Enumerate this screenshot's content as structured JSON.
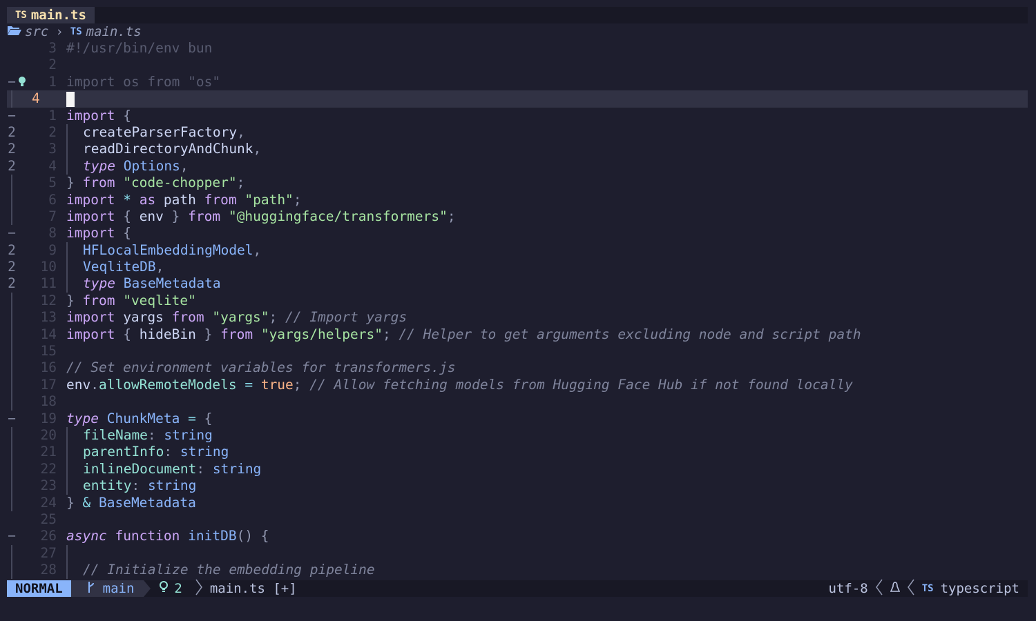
{
  "tabline": {
    "badge": "TS",
    "filename": "main.ts"
  },
  "winbar": {
    "folder_icon": "folder-open-icon",
    "dir": "src",
    "separator": "›",
    "badge": "TS",
    "file": "main.ts"
  },
  "buffer": {
    "lines": [
      {
        "fold": "",
        "sign": "",
        "nr": "3",
        "tokens": [
          [
            "dim",
            "#!/usr/bin/env bun",
            "plain"
          ]
        ]
      },
      {
        "fold": "",
        "sign": "",
        "nr": "2",
        "tokens": []
      },
      {
        "fold": "−",
        "sign": "lightbulb-icon",
        "nr": "1",
        "tokens": [
          [
            "dim",
            "import os from \"os\""
          ]
        ]
      },
      {
        "fold": "│",
        "sign": "",
        "nr": "4",
        "current": true,
        "tokens": []
      },
      {
        "fold": "−",
        "sign": "",
        "nr": "1",
        "tokens": [
          [
            "kw",
            "import"
          ],
          [
            "pu",
            " {"
          ]
        ]
      },
      {
        "fold": "2",
        "sign": "",
        "nr": "2",
        "indent": true,
        "tokens": [
          [
            "plain",
            "createParserFactory"
          ],
          [
            "pu",
            ","
          ]
        ]
      },
      {
        "fold": "2",
        "sign": "",
        "nr": "3",
        "indent": true,
        "tokens": [
          [
            "plain",
            "readDirectoryAndChunk"
          ],
          [
            "pu",
            ","
          ]
        ]
      },
      {
        "fold": "2",
        "sign": "",
        "nr": "4",
        "indent": true,
        "tokens": [
          [
            "it",
            "type"
          ],
          [
            "plain",
            " "
          ],
          [
            "ty",
            "Options"
          ],
          [
            "pu",
            ","
          ]
        ]
      },
      {
        "fold": "│",
        "sign": "",
        "nr": "5",
        "tokens": [
          [
            "pu",
            "} "
          ],
          [
            "kw",
            "from"
          ],
          [
            "plain",
            " "
          ],
          [
            "str",
            "\"code-chopper\""
          ],
          [
            "pu",
            ";"
          ]
        ]
      },
      {
        "fold": "│",
        "sign": "",
        "nr": "6",
        "tokens": [
          [
            "kw",
            "import"
          ],
          [
            "plain",
            " "
          ],
          [
            "op",
            "*"
          ],
          [
            "plain",
            " "
          ],
          [
            "kw",
            "as"
          ],
          [
            "plain",
            " path "
          ],
          [
            "kw",
            "from"
          ],
          [
            "plain",
            " "
          ],
          [
            "str",
            "\"path\""
          ],
          [
            "pu",
            ";"
          ]
        ]
      },
      {
        "fold": "│",
        "sign": "",
        "nr": "7",
        "tokens": [
          [
            "kw",
            "import"
          ],
          [
            "pu",
            " { "
          ],
          [
            "plain",
            "env"
          ],
          [
            "pu",
            " } "
          ],
          [
            "kw",
            "from"
          ],
          [
            "plain",
            " "
          ],
          [
            "str",
            "\"@huggingface/transformers\""
          ],
          [
            "pu",
            ";"
          ]
        ]
      },
      {
        "fold": "−",
        "sign": "",
        "nr": "8",
        "tokens": [
          [
            "kw",
            "import"
          ],
          [
            "pu",
            " {"
          ]
        ]
      },
      {
        "fold": "2",
        "sign": "",
        "nr": "9",
        "indent": true,
        "tokens": [
          [
            "ty",
            "HFLocalEmbeddingModel"
          ],
          [
            "pu",
            ","
          ]
        ]
      },
      {
        "fold": "2",
        "sign": "",
        "nr": "10",
        "indent": true,
        "tokens": [
          [
            "ty",
            "VeqliteDB"
          ],
          [
            "pu",
            ","
          ]
        ]
      },
      {
        "fold": "2",
        "sign": "",
        "nr": "11",
        "indent": true,
        "tokens": [
          [
            "it",
            "type"
          ],
          [
            "plain",
            " "
          ],
          [
            "ty",
            "BaseMetadata"
          ]
        ]
      },
      {
        "fold": "│",
        "sign": "",
        "nr": "12",
        "tokens": [
          [
            "pu",
            "} "
          ],
          [
            "kw",
            "from"
          ],
          [
            "plain",
            " "
          ],
          [
            "str",
            "\"veqlite\""
          ]
        ]
      },
      {
        "fold": "│",
        "sign": "",
        "nr": "13",
        "tokens": [
          [
            "kw",
            "import"
          ],
          [
            "plain",
            " yargs "
          ],
          [
            "kw",
            "from"
          ],
          [
            "plain",
            " "
          ],
          [
            "str",
            "\"yargs\""
          ],
          [
            "pu",
            "; "
          ],
          [
            "cm",
            "// Import yargs"
          ]
        ]
      },
      {
        "fold": "│",
        "sign": "",
        "nr": "14",
        "tokens": [
          [
            "kw",
            "import"
          ],
          [
            "pu",
            " { "
          ],
          [
            "plain",
            "hideBin"
          ],
          [
            "pu",
            " } "
          ],
          [
            "kw",
            "from"
          ],
          [
            "plain",
            " "
          ],
          [
            "str",
            "\"yargs/helpers\""
          ],
          [
            "pu",
            "; "
          ],
          [
            "cm",
            "// Helper to get arguments excluding node and script path"
          ]
        ]
      },
      {
        "fold": "│",
        "sign": "",
        "nr": "15",
        "tokens": []
      },
      {
        "fold": "│",
        "sign": "",
        "nr": "16",
        "tokens": [
          [
            "cm",
            "// Set environment variables for transformers.js"
          ]
        ]
      },
      {
        "fold": "│",
        "sign": "",
        "nr": "17",
        "tokens": [
          [
            "plain",
            "env"
          ],
          [
            "pu",
            "."
          ],
          [
            "pr",
            "allowRemoteModels"
          ],
          [
            "plain",
            " "
          ],
          [
            "op",
            "="
          ],
          [
            "plain",
            " "
          ],
          [
            "bool",
            "true"
          ],
          [
            "pu",
            "; "
          ],
          [
            "cm",
            "// Allow fetching models from Hugging Face Hub if not found locally"
          ]
        ]
      },
      {
        "fold": "│",
        "sign": "",
        "nr": "18",
        "tokens": []
      },
      {
        "fold": "−",
        "sign": "",
        "nr": "19",
        "tokens": [
          [
            "it",
            "type"
          ],
          [
            "plain",
            " "
          ],
          [
            "ty",
            "ChunkMeta"
          ],
          [
            "plain",
            " "
          ],
          [
            "op",
            "="
          ],
          [
            "pu",
            " {"
          ]
        ]
      },
      {
        "fold": "│",
        "sign": "",
        "nr": "20",
        "indent": true,
        "tokens": [
          [
            "pr",
            "fileName"
          ],
          [
            "pu",
            ": "
          ],
          [
            "ty",
            "string"
          ]
        ]
      },
      {
        "fold": "│",
        "sign": "",
        "nr": "21",
        "indent": true,
        "tokens": [
          [
            "pr",
            "parentInfo"
          ],
          [
            "pu",
            ": "
          ],
          [
            "ty",
            "string"
          ]
        ]
      },
      {
        "fold": "│",
        "sign": "",
        "nr": "22",
        "indent": true,
        "tokens": [
          [
            "pr",
            "inlineDocument"
          ],
          [
            "pu",
            ": "
          ],
          [
            "ty",
            "string"
          ]
        ]
      },
      {
        "fold": "│",
        "sign": "",
        "nr": "23",
        "indent": true,
        "tokens": [
          [
            "pr",
            "entity"
          ],
          [
            "pu",
            ": "
          ],
          [
            "ty",
            "string"
          ]
        ]
      },
      {
        "fold": "│",
        "sign": "",
        "nr": "24",
        "tokens": [
          [
            "pu",
            "} "
          ],
          [
            "op",
            "&"
          ],
          [
            "plain",
            " "
          ],
          [
            "ty",
            "BaseMetadata"
          ]
        ]
      },
      {
        "fold": "",
        "sign": "",
        "nr": "25",
        "tokens": []
      },
      {
        "fold": "−",
        "sign": "",
        "nr": "26",
        "tokens": [
          [
            "it",
            "async"
          ],
          [
            "plain",
            " "
          ],
          [
            "kw",
            "function"
          ],
          [
            "plain",
            " "
          ],
          [
            "fn",
            "initDB"
          ],
          [
            "pu",
            "() {"
          ]
        ]
      },
      {
        "fold": "│",
        "sign": "",
        "nr": "27",
        "indent": true,
        "tokens": []
      },
      {
        "fold": "│",
        "sign": "",
        "nr": "28",
        "indent": true,
        "tokens": [
          [
            "cm",
            "// Initialize the embedding pipeline"
          ]
        ]
      }
    ]
  },
  "statusline": {
    "mode": "NORMAL",
    "branch_icon": "git-branch-icon",
    "branch": "main",
    "diag_icon": "lightbulb-icon",
    "diag_count": "2",
    "filename": "main.ts [+]",
    "encoding": "utf-8",
    "os_icon": "tux-icon",
    "ft_badge": "TS",
    "filetype": "typescript"
  },
  "colors": {
    "bg": "#1e1e2e",
    "mode": "#89b4fa",
    "keyword": "#cba6f7",
    "string": "#a6e3a1",
    "comment": "#7f849c",
    "property": "#94e2d5",
    "boolean": "#fab387"
  }
}
